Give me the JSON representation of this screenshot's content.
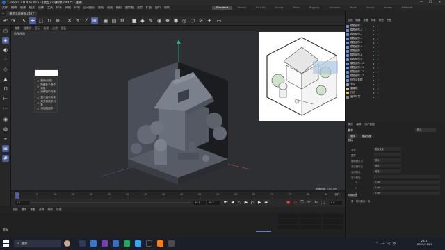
{
  "window": {
    "title": "Cinema 4D R26.015 - [模型小说精致.c4d *] - 主要",
    "controls": [
      "—",
      "☐",
      "✕"
    ]
  },
  "menubar": [
    "文件",
    "编辑",
    "创建",
    "模式",
    "选择",
    "工具",
    "样条",
    "网格",
    "体积",
    "运动图形",
    "角色",
    "动画",
    "模拟",
    "跟踪器",
    "渲染",
    "扩展",
    "窗口",
    "帮助"
  ],
  "layouts": [
    {
      "label": "Standard",
      "active": true
    },
    {
      "label": "Model",
      "active": false
    },
    {
      "label": "UV Edit",
      "active": false
    },
    {
      "label": "Sculpt",
      "active": false
    },
    {
      "label": "Paint",
      "active": false
    },
    {
      "label": "Rigging",
      "active": false
    },
    {
      "label": "Animate",
      "active": false
    },
    {
      "label": "Track",
      "active": false
    },
    {
      "label": "Script",
      "active": false
    },
    {
      "label": "Nodes",
      "active": false
    },
    {
      "label": "Redshift",
      "active": false
    }
  ],
  "tabs": [
    {
      "label": "+"
    },
    {
      "label": "模型小说精致.c4d *"
    }
  ],
  "viewport": {
    "menu": [
      "查看",
      "摄像机",
      "显示",
      "选项",
      "过滤",
      "面板"
    ],
    "label": "透视视图",
    "grid_info": "网格间距: 100 cm"
  },
  "context_menu": {
    "items": [
      "撤销(动作)",
      "隐藏多个选中对象",
      "分解选中对象",
      "显示选中对象",
      "对齐到选中对象",
      "添加到组中"
    ]
  },
  "timeline": {
    "ticks": [
      "0",
      "5",
      "10",
      "15",
      "20",
      "25",
      "30",
      "35",
      "40",
      "45",
      "50",
      "55",
      "60",
      "65",
      "70",
      "75",
      "80",
      "85",
      "90"
    ],
    "current_frame": "0 F",
    "start": "0 F",
    "end": "90 F",
    "end_field": "90 F",
    "max": "0 F"
  },
  "lower_tabs": [
    "创建",
    "编辑",
    "查看",
    "选择",
    "材质",
    "纹理"
  ],
  "lower_label": "坐标",
  "object_manager": {
    "menu": [
      "文件",
      "编辑",
      "查看",
      "对象",
      "标签",
      "书签"
    ],
    "objects": [
      "模型细节.1",
      "模型细节.2",
      "模型细节.3",
      "模型细节.4",
      "模型细节.5",
      "模型细节.6",
      "模型细节.7",
      "模型细节.8",
      "模型细节.9",
      "模型细节.10",
      "模型细节.11",
      "模型细节.12",
      "模型细节.13",
      "挤压对象群",
      "天空",
      "摄像机",
      "灯光",
      "室内环境"
    ]
  },
  "attributes": {
    "menu": [
      "模式",
      "编辑",
      "用户数据"
    ],
    "section": "基本",
    "tabs": [
      "基本",
      "渲染设置"
    ],
    "preset": "默认",
    "section2": "坐标",
    "fields": [
      {
        "label": "名称",
        "value": "渲染设置"
      },
      {
        "label": "图层",
        "value": ""
      },
      {
        "label": "编辑器可见",
        "value": "默认"
      },
      {
        "label": "渲染器可见",
        "value": "默认"
      },
      {
        "label": "使用颜色",
        "value": "关闭"
      },
      {
        "label": "显示颜色",
        "value": ""
      },
      {
        "label": "X",
        "value": "0 cm"
      },
      {
        "label": "Y",
        "value": "0 cm"
      },
      {
        "label": "Z",
        "value": "0 cm"
      }
    ],
    "footer": "可用标签",
    "footer_sub": "第一帧到最后一帧"
  },
  "taskbar": {
    "search": "搜索",
    "time": "21:47",
    "date": "2022/11/20"
  },
  "colors": {
    "accent": "#4b5f9d",
    "viewport_bg": "#2d2f32",
    "axis_y": "#2db36a",
    "axis_x": "#d6433b",
    "check": "#2fc94a"
  }
}
